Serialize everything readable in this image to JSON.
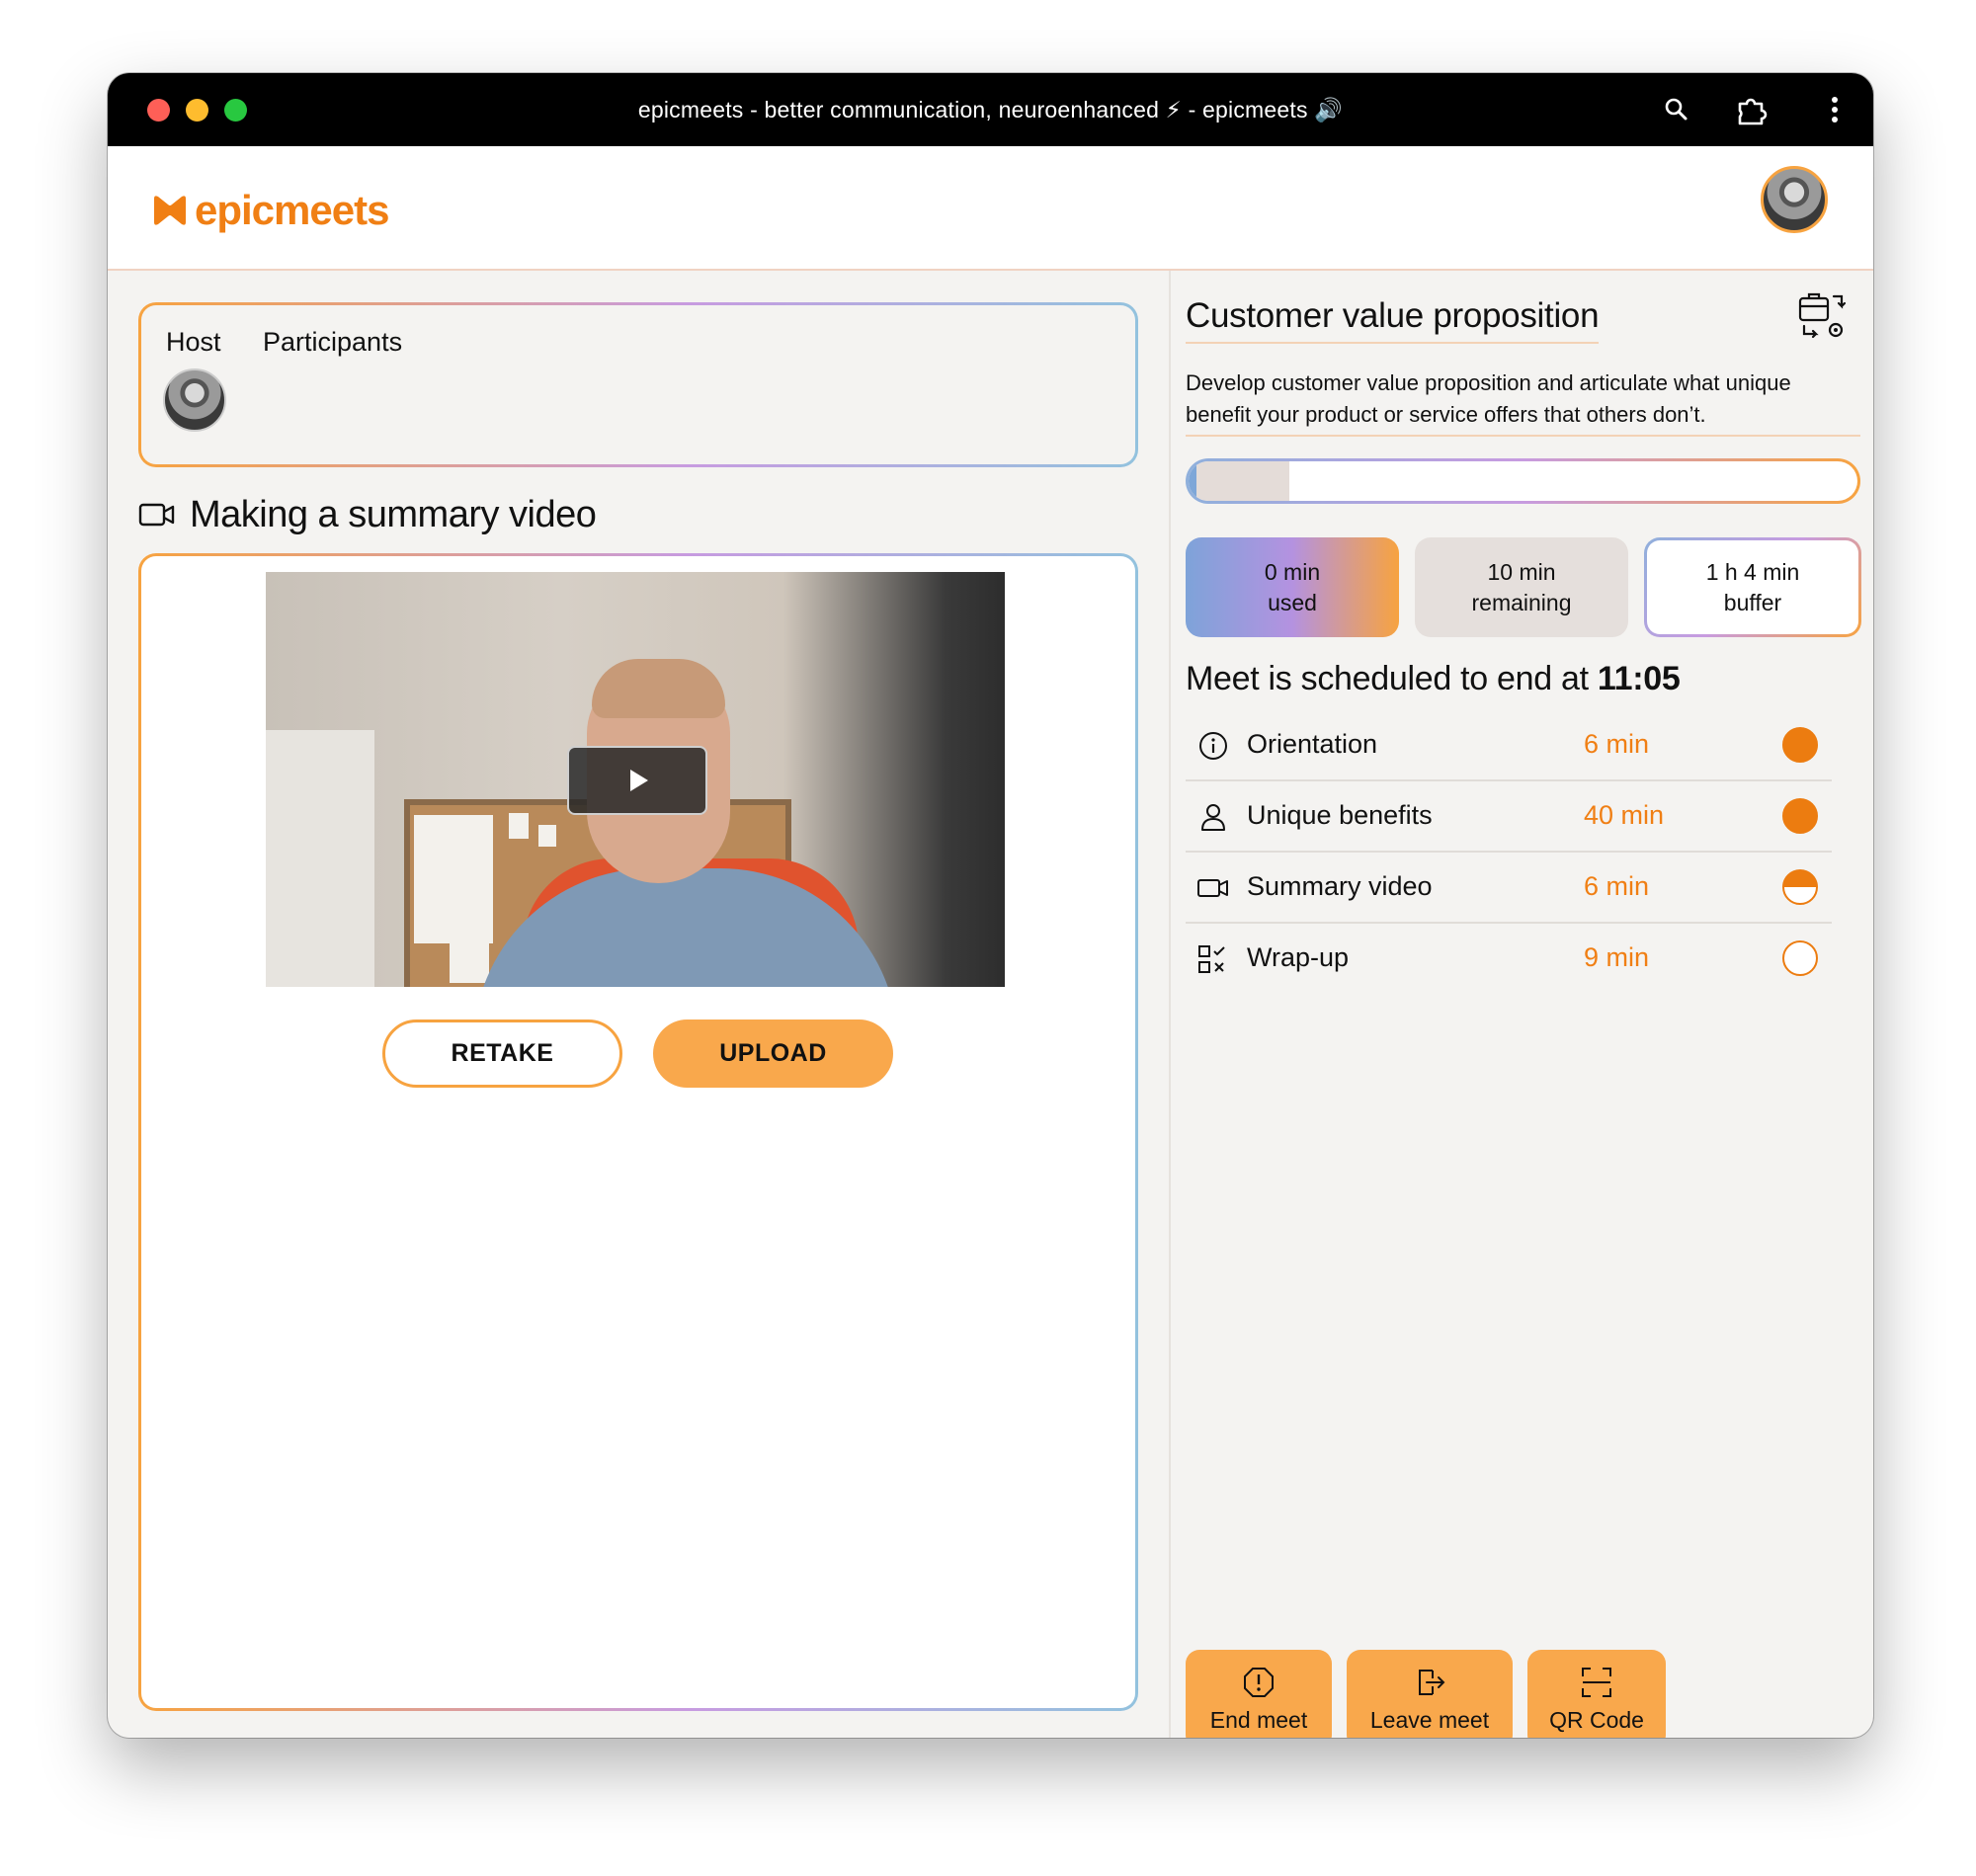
{
  "window": {
    "title": "epicmeets - better communication, neuroenhanced ⚡ - epicmeets 🔊"
  },
  "brand": {
    "name": "epicmeets",
    "accent": "#f07f14"
  },
  "participants_panel": {
    "tabs": [
      "Host",
      "Participants"
    ]
  },
  "video_section": {
    "title": "Making a summary video",
    "retake_label": "RETAKE",
    "upload_label": "UPLOAD"
  },
  "phase": {
    "title": "Customer value proposition",
    "description": "Develop customer value proposition and articulate what unique benefit your product or service offers that others don’t.",
    "progress_fraction": 0.15
  },
  "stats": {
    "used_value": "0 min",
    "used_label": "used",
    "remaining_value": "10 min",
    "remaining_label": "remaining",
    "buffer_value": "1 h 4 min",
    "buffer_label": "buffer"
  },
  "schedule": {
    "prefix": "Meet is scheduled to end at ",
    "end_time": "11:05"
  },
  "agenda": [
    {
      "label": "Orientation",
      "minutes": "6 min",
      "icon": "info-icon",
      "status": "complete"
    },
    {
      "label": "Unique benefits",
      "minutes": "40 min",
      "icon": "person-icon",
      "status": "complete"
    },
    {
      "label": "Summary video",
      "minutes": "6 min",
      "icon": "video-camera-icon",
      "status": "in-progress"
    },
    {
      "label": "Wrap-up",
      "minutes": "9 min",
      "icon": "checklist-icon",
      "status": "not-started"
    }
  ],
  "actions": {
    "end_label": "End meet",
    "leave_label": "Leave meet",
    "qr_label": "QR Code"
  }
}
